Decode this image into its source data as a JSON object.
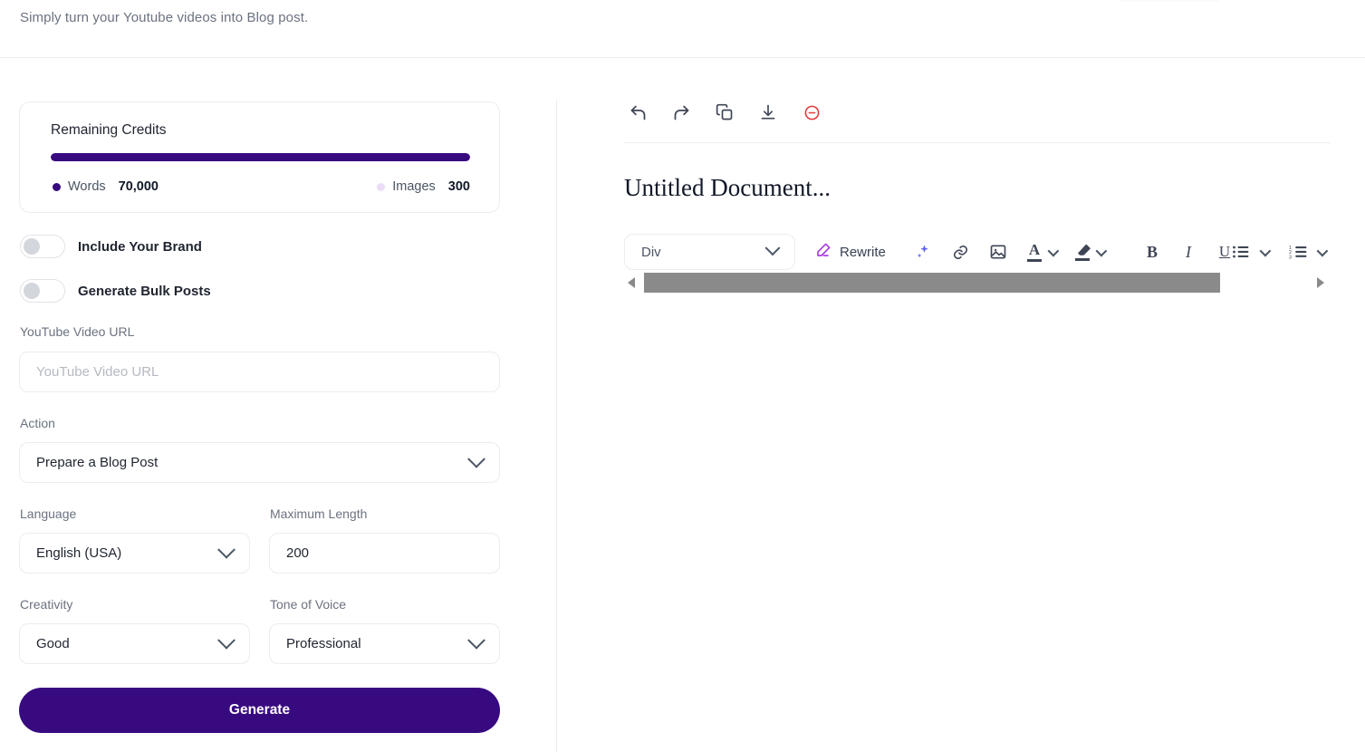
{
  "header": {
    "subtitle": "Simply turn your Youtube videos into Blog post."
  },
  "colors": {
    "brand_purple": "#380A80",
    "progress_track": "#ECE9F5",
    "words_dot": "#380A80",
    "images_dot": "#EBDCF8",
    "danger_red": "#E23B3B",
    "rewrite_purple": "#A435E0",
    "sparkle_blue": "#6366F1",
    "toolbar_icon": "#3E4555",
    "scrollbar_thumb": "#8A8A8A"
  },
  "credits": {
    "title": "Remaining Credits",
    "progress_percent": 100,
    "words": {
      "label": "Words",
      "value": "70,000",
      "dot": "words-dot"
    },
    "images": {
      "label": "Images",
      "value": "300",
      "dot": "images-dot"
    }
  },
  "toggles": [
    {
      "label": "Include Your Brand",
      "on": false
    },
    {
      "label": "Generate Bulk Posts",
      "on": false
    }
  ],
  "form": {
    "youtube_url": {
      "label": "YouTube Video URL",
      "value": "",
      "placeholder": "YouTube Video URL"
    },
    "action": {
      "label": "Action",
      "value": "Prepare a Blog Post"
    },
    "language": {
      "label": "Language",
      "value": "English (USA)"
    },
    "maximum_length": {
      "label": "Maximum Length",
      "value": "200"
    },
    "creativity": {
      "label": "Creativity",
      "value": "Good"
    },
    "tone_of_voice": {
      "label": "Tone of Voice",
      "value": "Professional"
    },
    "generate_button": "Generate"
  },
  "editor": {
    "document_title": "Untitled Document...",
    "top_tools": [
      {
        "name": "undo-icon",
        "label": "Undo"
      },
      {
        "name": "redo-icon",
        "label": "Redo"
      },
      {
        "name": "copy-icon",
        "label": "Copy"
      },
      {
        "name": "download-icon",
        "label": "Download"
      },
      {
        "name": "remove-circle-icon",
        "label": "Delete"
      }
    ],
    "format_bar": {
      "block_type": "Div",
      "rewrite_label": "Rewrite",
      "tools": [
        {
          "name": "ai-sparkle-icon",
          "label": "AI Assist"
        },
        {
          "name": "link-icon",
          "label": "Insert Link"
        },
        {
          "name": "image-icon",
          "label": "Insert Image"
        },
        {
          "name": "text-color-icon",
          "label": "Text Color"
        },
        {
          "name": "highlight-icon",
          "label": "Highlight Color"
        },
        {
          "name": "bold-icon",
          "label": "Bold"
        },
        {
          "name": "italic-icon",
          "label": "Italic"
        },
        {
          "name": "underline-icon",
          "label": "Underline"
        },
        {
          "name": "bullet-list-icon",
          "label": "Bulleted List"
        },
        {
          "name": "numbered-list-icon",
          "label": "Numbered List"
        }
      ],
      "bold_glyph": "B",
      "italic_glyph": "I",
      "underline_glyph": "U",
      "text_color_glyph": "A"
    },
    "scrollbar": {
      "position_percent": 0
    }
  }
}
